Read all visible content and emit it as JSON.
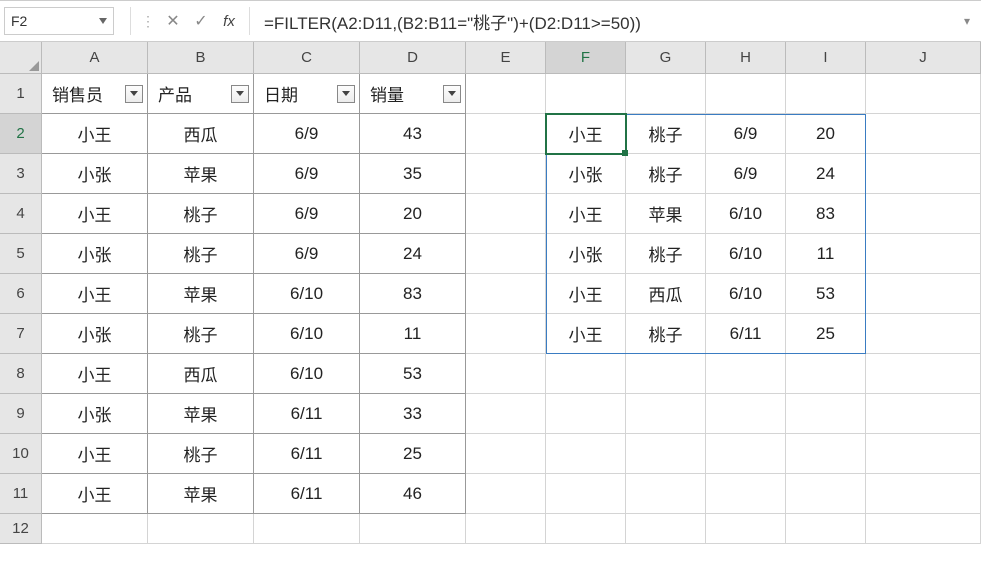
{
  "namebox": {
    "value": "F2"
  },
  "formula_bar": {
    "value": "=FILTER(A2:D11,(B2:B11=\"桃子\")+(D2:D11>=50))"
  },
  "columns": [
    "A",
    "B",
    "C",
    "D",
    "E",
    "F",
    "G",
    "H",
    "I",
    "J"
  ],
  "rows": [
    "1",
    "2",
    "3",
    "4",
    "5",
    "6",
    "7",
    "8",
    "9",
    "10",
    "11",
    "12"
  ],
  "table": {
    "headers": [
      "销售员",
      "产品",
      "日期",
      "销量"
    ],
    "rows": [
      [
        "小王",
        "西瓜",
        "6/9",
        "43"
      ],
      [
        "小张",
        "苹果",
        "6/9",
        "35"
      ],
      [
        "小王",
        "桃子",
        "6/9",
        "20"
      ],
      [
        "小张",
        "桃子",
        "6/9",
        "24"
      ],
      [
        "小王",
        "苹果",
        "6/10",
        "83"
      ],
      [
        "小张",
        "桃子",
        "6/10",
        "11"
      ],
      [
        "小王",
        "西瓜",
        "6/10",
        "53"
      ],
      [
        "小张",
        "苹果",
        "6/11",
        "33"
      ],
      [
        "小王",
        "桃子",
        "6/11",
        "25"
      ],
      [
        "小王",
        "苹果",
        "6/11",
        "46"
      ]
    ]
  },
  "result": {
    "rows": [
      [
        "小王",
        "桃子",
        "6/9",
        "20"
      ],
      [
        "小张",
        "桃子",
        "6/9",
        "24"
      ],
      [
        "小王",
        "苹果",
        "6/10",
        "83"
      ],
      [
        "小张",
        "桃子",
        "6/10",
        "11"
      ],
      [
        "小王",
        "西瓜",
        "6/10",
        "53"
      ],
      [
        "小王",
        "桃子",
        "6/11",
        "25"
      ]
    ]
  },
  "fb_icons": {
    "cancel": "✕",
    "enter": "✓",
    "fx": "fx",
    "dots": "⋮",
    "expand": "▾"
  }
}
